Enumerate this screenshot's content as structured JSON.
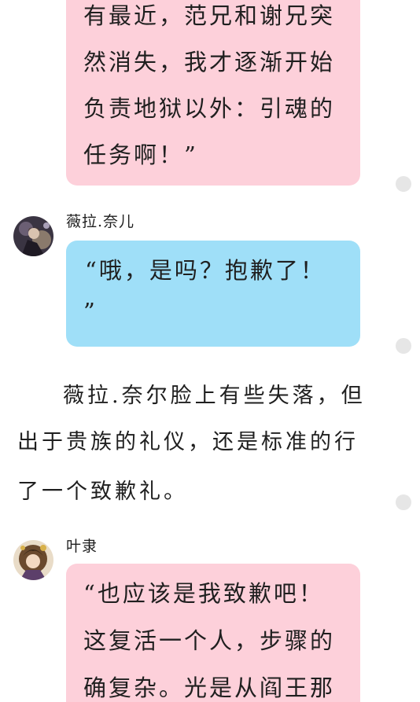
{
  "messages": [
    {
      "lines": [
        "有最近，范兄和谢兄突",
        "然消失，我才逐渐开始",
        "负责地狱以外：引魂的",
        "任务啊！”"
      ]
    },
    {
      "speaker": "薇拉.奈儿",
      "lines": [
        "“哦，是吗？抱歉了！",
        "”"
      ]
    },
    {
      "speaker": "叶隶",
      "lines": [
        "“也应该是我致歉吧！",
        "这复活一个人，步骤的",
        "确复杂。光是从阎王那"
      ]
    }
  ],
  "narration": {
    "lines": [
      "薇拉.奈尔脸上有些失落，但",
      "出于贵族的礼仪，还是标准的行",
      "了一个致歉礼。"
    ]
  },
  "colors": {
    "pink_bubble": "#fdd0da",
    "blue_bubble": "#9fdff8",
    "dot": "#e6e6e6"
  },
  "icons": [
    "avatar-vera-icon",
    "avatar-yeli-icon",
    "comment-dot-icon"
  ]
}
